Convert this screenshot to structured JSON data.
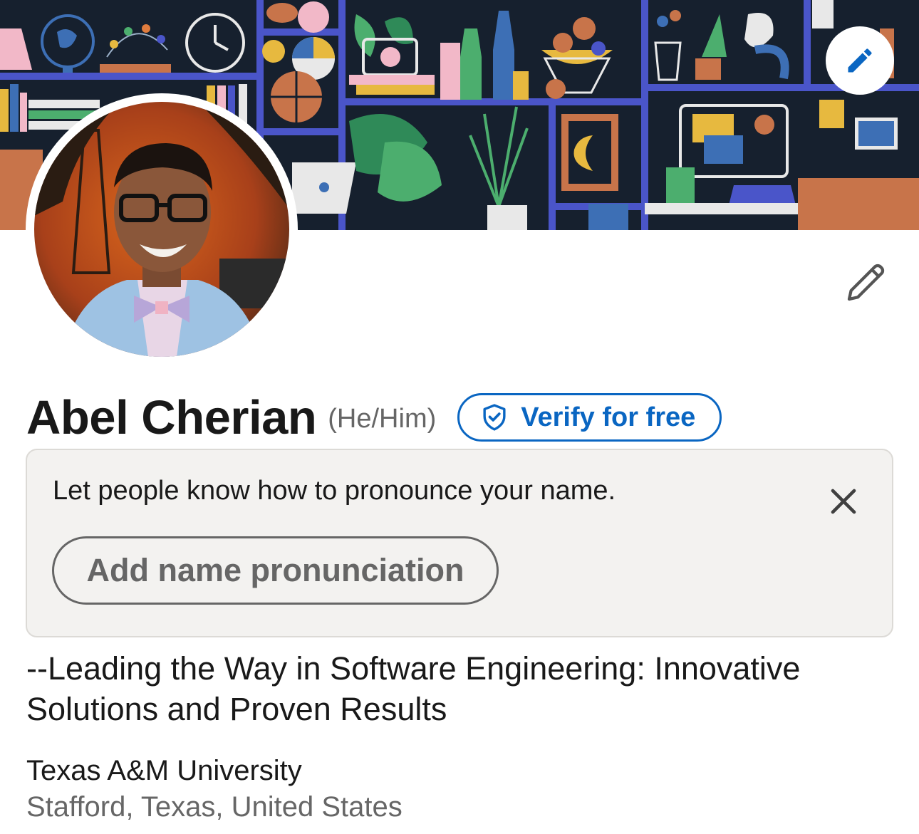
{
  "profile": {
    "name": "Abel Cherian",
    "pronouns": "(He/Him)",
    "verify_label": "Verify for free",
    "headline": "--Leading the Way in Software Engineering: Innovative Solutions and Proven Results",
    "education": "Texas A&M University",
    "location": "Stafford, Texas, United States"
  },
  "pronunciation_prompt": {
    "message": "Let people know how to pronounce your name.",
    "button_label": "Add name pronunciation"
  },
  "icons": {
    "banner_edit": "pencil-icon",
    "profile_edit": "pencil-outline-icon",
    "verify": "shield-check-icon",
    "dismiss": "close-icon"
  },
  "colors": {
    "accent": "#0a66c2",
    "text_primary": "#191919",
    "text_secondary": "#666666",
    "card_background": "#f3f2f0"
  }
}
